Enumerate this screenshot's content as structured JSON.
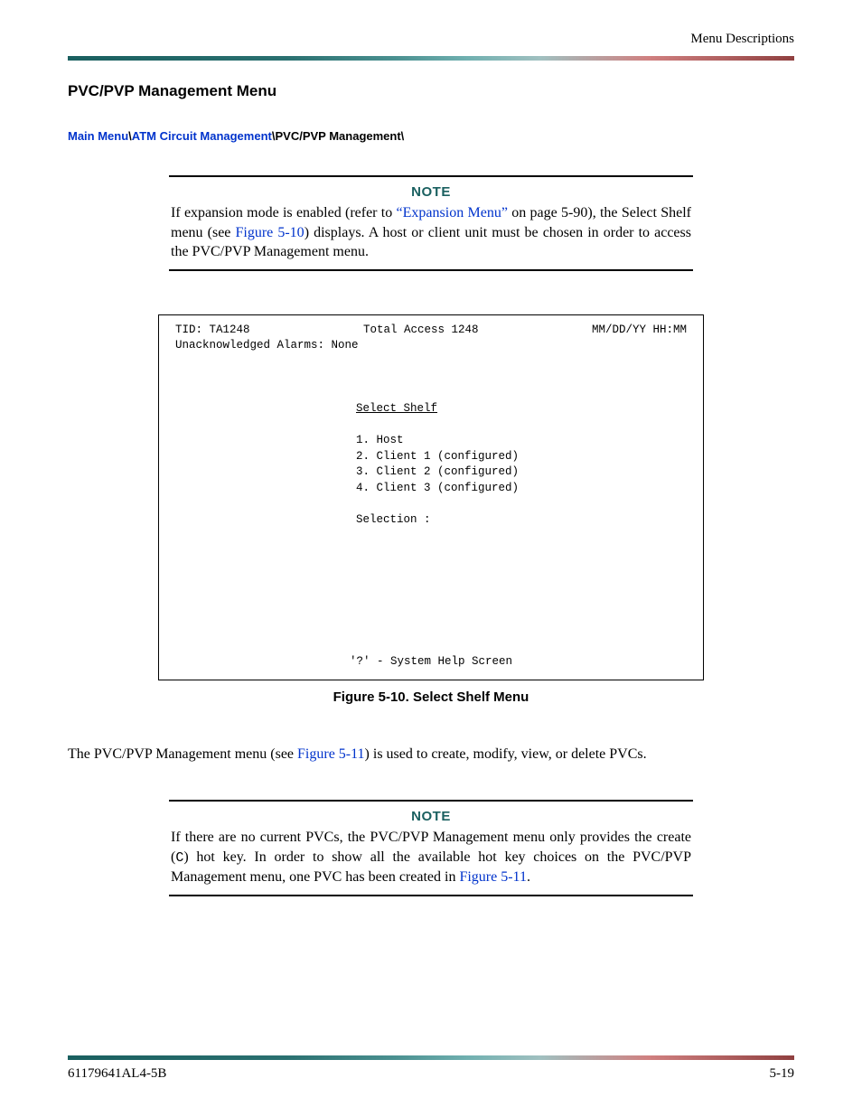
{
  "header": {
    "right_text": "Menu Descriptions"
  },
  "section": {
    "title": "PVC/PVP Management Menu"
  },
  "breadcrumb": {
    "link1": "Main Menu",
    "sep1": "\\",
    "link2": "ATM Circuit Management",
    "sep2": "\\",
    "current": "PVC/PVP Management\\"
  },
  "note1": {
    "title": "NOTE",
    "pre_text": "If expansion mode is enabled (refer to ",
    "link1": "“Expansion Menu”",
    "mid1": " on page 5-90), the Select Shelf menu (see ",
    "link2": "Figure 5-10",
    "post_text": ") displays. A host or client unit must be chosen in order to access the PVC/PVP Management menu."
  },
  "terminal": {
    "tid": "TID: TA1248",
    "center_title": "Total Access 1248",
    "datetime": "MM/DD/YY  HH:MM",
    "alarms": "Unacknowledged Alarms: None",
    "menu_title": "Select Shelf",
    "opt1": "1. Host",
    "opt2": "2. Client 1 (configured)",
    "opt3": "3. Client 2 (configured)",
    "opt4": "4. Client 3 (configured)",
    "selection": "Selection :",
    "help": "'?' - System Help Screen"
  },
  "figure_caption": "Figure 5-10.  Select Shelf Menu",
  "body_para": {
    "pre": "The PVC/PVP Management menu (see ",
    "link": "Figure 5-11",
    "post": ") is used to create, modify, view, or delete PVCs."
  },
  "note2": {
    "title": "NOTE",
    "pre": "If there are no current PVCs, the PVC/PVP Management menu only provides the create (",
    "mono": "C",
    "mid": ") hot key. In order to show all the available hot key choices on the PVC/PVP Management menu, one PVC has been created in ",
    "link": "Figure 5-11",
    "post": "."
  },
  "footer": {
    "left": "61179641AL4-5B",
    "right": "5-19"
  }
}
